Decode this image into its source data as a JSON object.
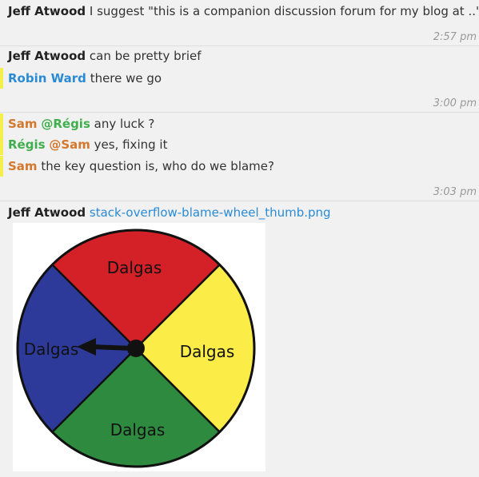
{
  "messages": [
    {
      "author": "Jeff Atwood",
      "text": "I suggest \"this is a companion discussion forum for my blog at ..\""
    },
    {
      "time": "2:57 pm"
    },
    {
      "author": "Jeff Atwood",
      "text": "can be pretty brief"
    },
    {
      "author": "Robin Ward",
      "text": "there we go"
    },
    {
      "time": "3:00 pm"
    },
    {
      "author": "Sam",
      "mention": "@Régis",
      "text": "any luck ?"
    },
    {
      "author": "Régis",
      "mention": "@Sam",
      "text": "yes, fixing it"
    },
    {
      "author": "Sam",
      "text": "the key question is, who do we blame?"
    },
    {
      "time": "3:03 pm"
    },
    {
      "author": "Jeff Atwood",
      "link": "stack-overflow-blame-wheel_thumb.png"
    }
  ],
  "image": {
    "segments": [
      {
        "label": "Dalgas",
        "color": "#d42027"
      },
      {
        "label": "Dalgas",
        "color": "#fbec47"
      },
      {
        "label": "Dalgas",
        "color": "#2e8a3e"
      },
      {
        "label": "Dalgas",
        "color": "#2d3a9a"
      }
    ]
  },
  "colors": {
    "robin": "#2a8bd4",
    "sam": "#d3782c",
    "regis": "#3faf4d",
    "highlight": "#f4ef4a",
    "link": "#2a8bd4"
  }
}
